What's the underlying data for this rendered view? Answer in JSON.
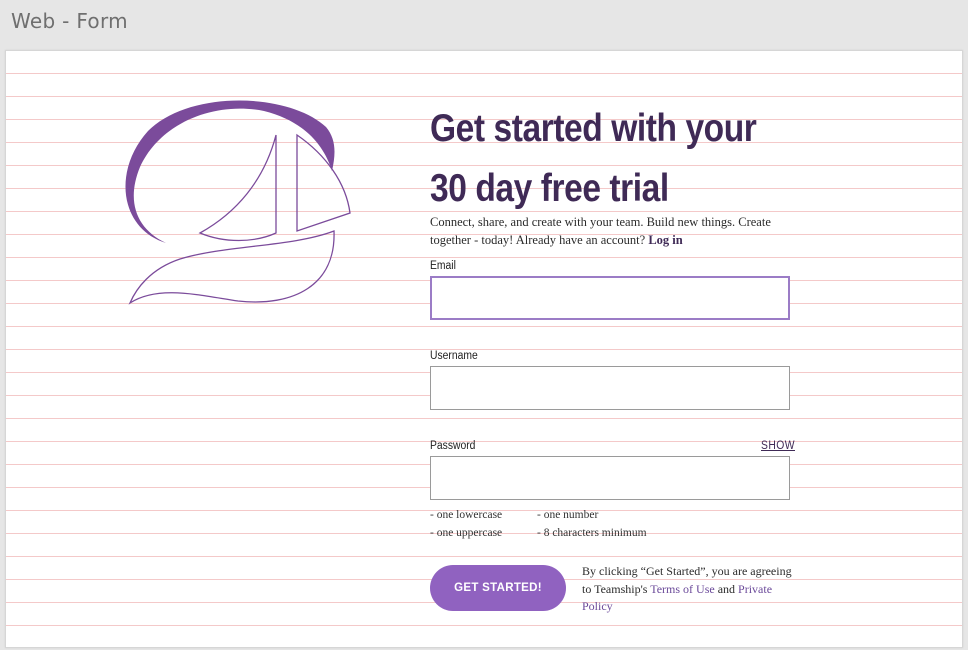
{
  "window": {
    "title": "Web - Form"
  },
  "brand": {
    "accent": "#9062c0",
    "heading_color": "#3f2a56",
    "logo_color": "#7b4b9b"
  },
  "logo": {
    "icon": "sailboat-logo-icon"
  },
  "hero": {
    "heading_line1": "Get started with your",
    "heading_line2": "30 day free trial",
    "intro_text": "Connect, share, and create with your team. Build new things. Create together - today! Already have an account?",
    "login_link": "Log in"
  },
  "form": {
    "email": {
      "label": "Email",
      "value": "",
      "placeholder": ""
    },
    "username": {
      "label": "Username",
      "value": "",
      "placeholder": ""
    },
    "password": {
      "label": "Password",
      "value": "",
      "placeholder": "",
      "show_label": "SHOW",
      "hints": {
        "lowercase": "- one lowercase",
        "number": "- one number",
        "uppercase": "- one uppercase",
        "min_chars": "- 8 characters minimum"
      }
    },
    "submit_label": "GET STARTED!",
    "legal": {
      "prefix": "By clicking “Get Started”, you are agreeing to Teamship's",
      "terms_link": "Terms of Use",
      "and": "and",
      "privacy_link": "Private Policy"
    }
  }
}
